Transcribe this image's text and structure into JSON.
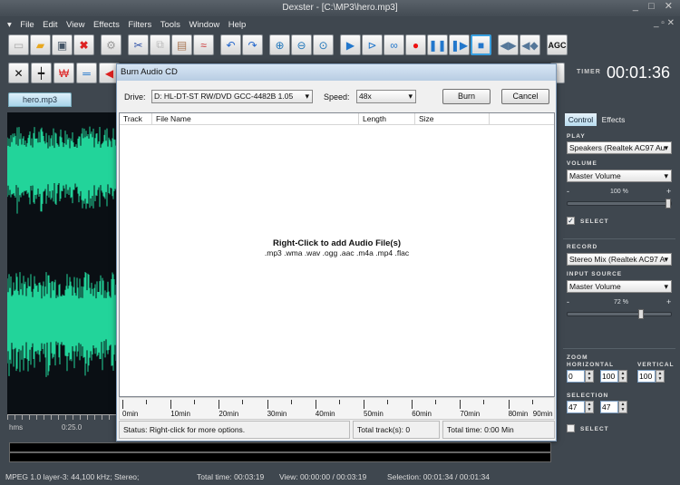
{
  "window": {
    "title": "Dexster - [C:\\MP3\\hero.mp3]",
    "controls": "_ □ ✕",
    "mdi_controls": "_ ▫ ✕"
  },
  "menu": [
    "File",
    "Edit",
    "View",
    "Effects",
    "Filters",
    "Tools",
    "Window",
    "Help"
  ],
  "toolbar1": {
    "agc_label": "AGC"
  },
  "timer": {
    "label": "TIMER",
    "value": "00:01:36"
  },
  "file_tab": "hero.mp3",
  "ruler": {
    "unit": "hms",
    "mark": "0:25.0"
  },
  "status_bar": {
    "format": "MPEG 1.0 layer-3: 44,100 kHz; Stereo;",
    "total": "Total time: 00:03:19",
    "view": "View: 00:00:00 / 00:03:19",
    "selection": "Selection: 00:01:34 / 00:01:34"
  },
  "right_panel": {
    "tabs": [
      "Control",
      "Effects"
    ],
    "play_label": "PLAY",
    "play_device": "Speakers (Realtek AC97 Au",
    "volume_label": "VOLUME",
    "volume_source": "Master Volume",
    "volume_percent": "100 %",
    "volume_value": 100,
    "select_label": "SELECT",
    "record_label": "RECORD",
    "record_device": "Stereo Mix (Realtek AC97 A",
    "input_label": "INPUT SOURCE",
    "input_source": "Master Volume",
    "input_percent": "72 %",
    "input_value": 72,
    "minus": "-",
    "plus": "+",
    "zoom_label": "ZOOM",
    "horizontal_label": "HORIZONTAL",
    "vertical_label": "VERTICAL",
    "zoom_h_from": "0",
    "zoom_h_to": "100",
    "zoom_v": "100",
    "selection_label": "SELECTION",
    "sel_from": "47",
    "sel_to": "47",
    "select2_label": "SELECT"
  },
  "dialog": {
    "title": "Burn Audio CD",
    "drive_label": "Drive:",
    "drive_value": "D: HL-DT-ST RW/DVD GCC-4482B 1.05",
    "speed_label": "Speed:",
    "speed_value": "48x",
    "burn": "Burn",
    "cancel": "Cancel",
    "columns": [
      "Track",
      "File Name",
      "Length",
      "Size"
    ],
    "hint_title": "Right-Click to add Audio File(s)",
    "hint_formats": ".mp3 .wma .wav .ogg .aac .m4a .mp4 .flac",
    "ruler_ticks": [
      "0min",
      "10min",
      "20min",
      "30min",
      "40min",
      "50min",
      "60min",
      "70min",
      "80min",
      "90min"
    ],
    "status": "Status: Right-click for more options.",
    "tracks": "Total track(s): 0",
    "total_time": "Total time: 0:00 Min"
  }
}
